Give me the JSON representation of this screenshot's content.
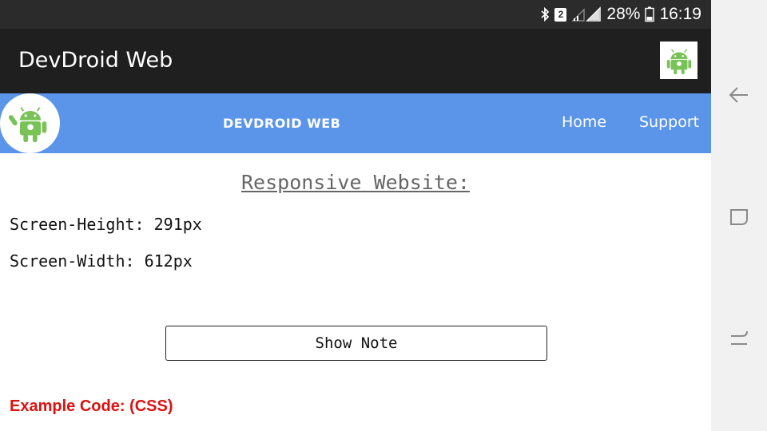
{
  "status_bar": {
    "sim_label": "2",
    "battery": "28%",
    "time": "16:19"
  },
  "app": {
    "title": "DevDroid Web"
  },
  "web_nav": {
    "brand": "DEVDROID WEB",
    "links": [
      "Home",
      "Support"
    ],
    "color": "#5b95e9"
  },
  "content": {
    "heading": "Responsive Website:",
    "screen_height": "Screen-Height: 291px",
    "screen_width": "Screen-Width: 612px",
    "show_note_label": "Show Note",
    "example_code": "Example Code: (CSS)",
    "example_color": "#dd1111"
  },
  "icons": {
    "bluetooth": "bluetooth-icon",
    "signal": "signal-icon",
    "battery": "battery-icon",
    "android_logo": "android-logo-icon",
    "back": "back-icon",
    "recents": "recents-icon",
    "home": "home-icon"
  }
}
